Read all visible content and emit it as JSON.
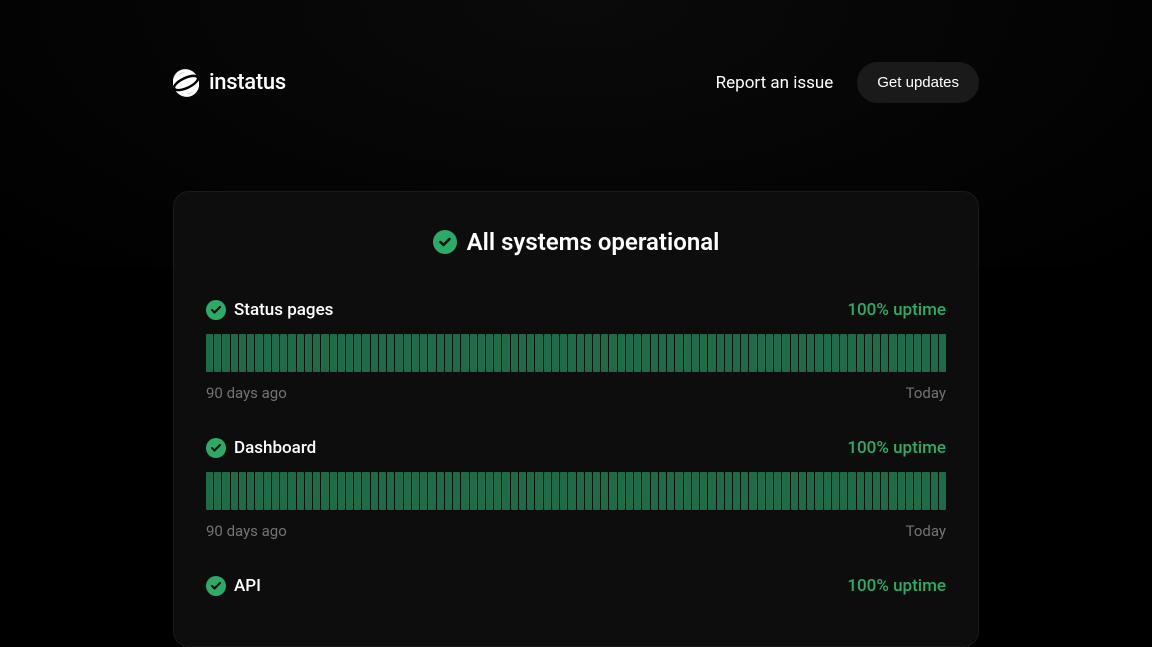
{
  "logo": {
    "text": "instatus"
  },
  "header": {
    "report_link": "Report an issue",
    "get_updates": "Get updates"
  },
  "status": {
    "title": "All systems operational"
  },
  "timeframe": {
    "start": "90 days ago",
    "end": "Today"
  },
  "components": [
    {
      "name": "Status pages",
      "uptime": "100% uptime"
    },
    {
      "name": "Dashboard",
      "uptime": "100% uptime"
    },
    {
      "name": "API",
      "uptime": "100% uptime"
    }
  ],
  "colors": {
    "operational": "#2bab66",
    "bar": "#1e6b47"
  }
}
